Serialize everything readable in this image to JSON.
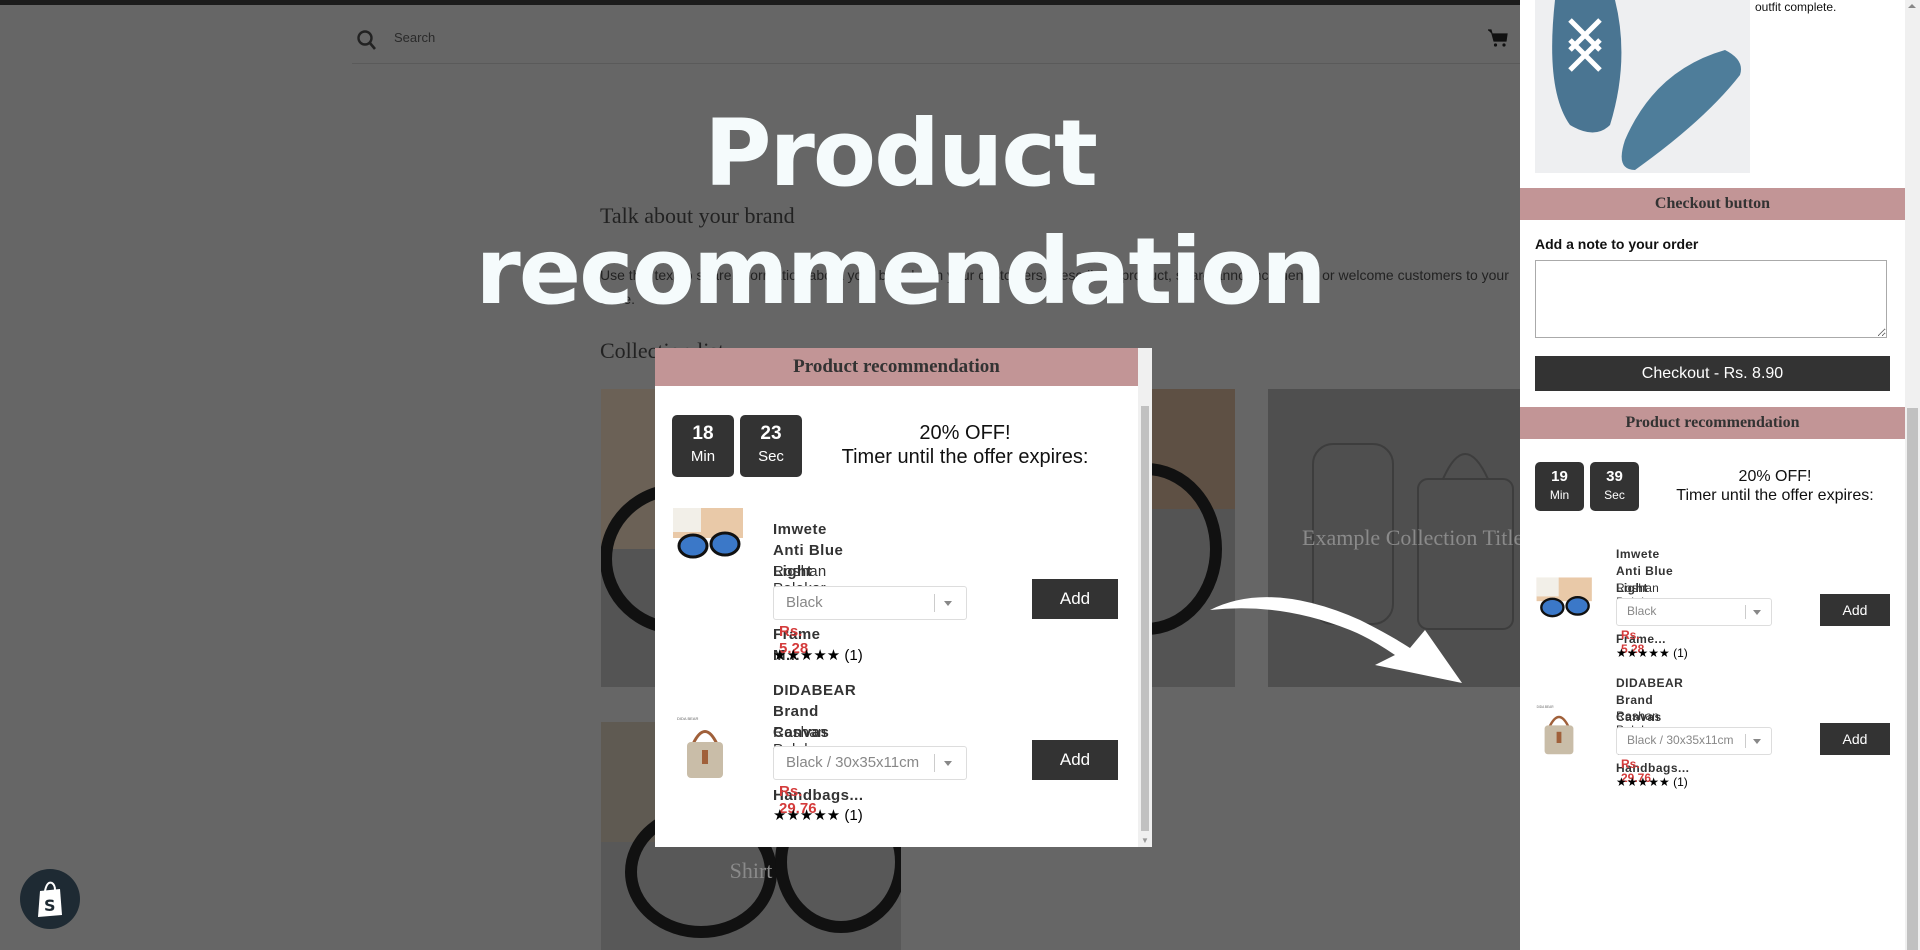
{
  "store": {
    "search_placeholder": "Search",
    "brand_title": "Talk about your brand",
    "brand_body": "Use this text to share information about your brand with your customers. Describe a product, share announcements, or welcome customers to your store.",
    "collection_title": "Collection list",
    "tiles": [
      {
        "label": ""
      },
      {
        "label": "Example Collection Title"
      },
      {
        "label": "Shirt"
      }
    ]
  },
  "overlay": {
    "title_line1": "Product",
    "title_line2": "recommendation"
  },
  "modal": {
    "header": "Product recommendation",
    "timer": {
      "minutes": "18",
      "min_label": "Min",
      "seconds": "23",
      "sec_label": "Sec"
    },
    "offer_line1": "20% OFF!",
    "offer_line2": "Timer until the offer expires:",
    "products": [
      {
        "name_line1": "Imwete Anti Blue Light",
        "name_line2": "Computer Glasses Frame M...",
        "vendor": "Roshan Polekar",
        "variant": "Black",
        "price": "Rs. 5.28",
        "stars": "★★★★★",
        "rating": 5,
        "reviews": "(1)",
        "add_label": "Add"
      },
      {
        "name_line1": "DIDABEAR Brand Canvas",
        "name_line2": "Tote Bag Women Handbags...",
        "vendor": "Roshan Polekar",
        "variant": "Black / 30x35x11cm",
        "price": "Rs. 29.76",
        "stars": "★★★★★",
        "rating": 5,
        "reviews": "(1)",
        "add_label": "Add"
      }
    ]
  },
  "cart_panel": {
    "outfit_text": "outfit complete.",
    "checkout_header": "Checkout button",
    "note_label": "Add a note to your order",
    "note_value": "",
    "checkout_label": "Checkout - Rs. 8.90",
    "reco_header": "Product recommendation",
    "timer": {
      "minutes": "19",
      "min_label": "Min",
      "seconds": "39",
      "sec_label": "Sec"
    },
    "offer_line1": "20% OFF!",
    "offer_line2": "Timer until the offer expires:",
    "products": [
      {
        "name_line1": "Imwete Anti Blue Light",
        "name_line2": "Computer Glasses Frame...",
        "vendor": "Roshan Polekar",
        "variant": "Black",
        "price": "Rs. 5.28",
        "stars": "★★★★★",
        "rating": 5,
        "reviews": "(1)",
        "add_label": "Add"
      },
      {
        "name_line1": "DIDABEAR Brand Canvas",
        "name_line2": "Tote Bag Women Handbags...",
        "vendor": "Roshan Polekar",
        "variant": "Black / 30x35x11cm",
        "price": "Rs. 29.76",
        "stars": "★★★★★",
        "rating": 5,
        "reviews": "(1)",
        "add_label": "Add"
      }
    ]
  },
  "colors": {
    "header_pink": "#c29596",
    "checkout_header_dim": "#a87c7c",
    "dark_button": "#333333",
    "price_red": "#d43b3b",
    "backdrop": "#666666"
  }
}
